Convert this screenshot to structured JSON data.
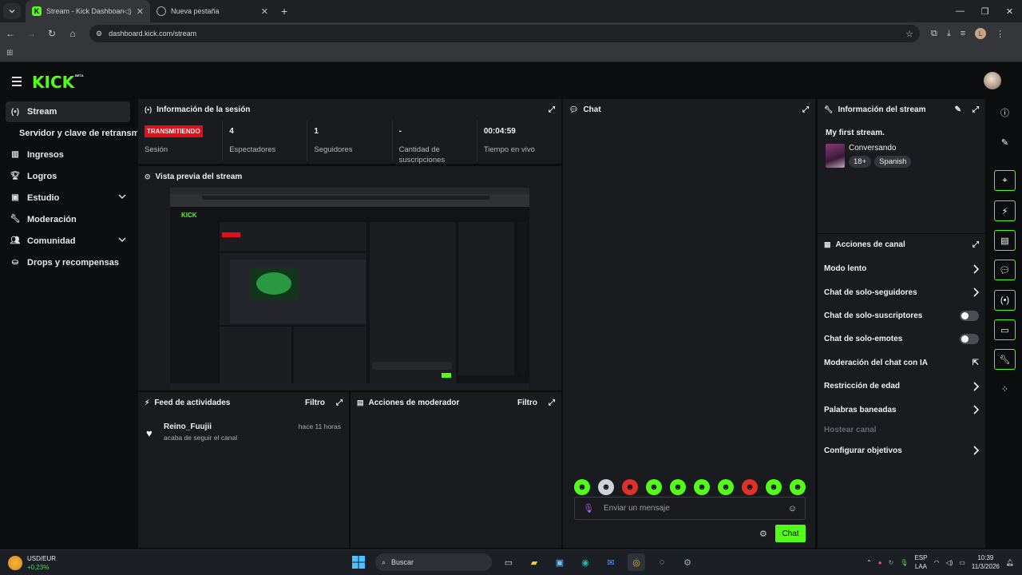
{
  "browser": {
    "tabs": [
      {
        "title": "Stream - Kick Dashboard",
        "active": true
      },
      {
        "title": "Nueva pestaña",
        "active": false
      }
    ],
    "url": "dashboard.kick.com/stream",
    "profile_initial": "L"
  },
  "app": {
    "logo": "KICK",
    "logo_badge": "BETA",
    "nav": [
      {
        "label": "Stream",
        "icon": "broadcast-icon",
        "active": true
      },
      {
        "label": "Servidor y clave de retransmisión",
        "sub": true
      },
      {
        "label": "Ingresos",
        "icon": "chart-icon"
      },
      {
        "label": "Logros",
        "icon": "trophy-icon"
      },
      {
        "label": "Estudio",
        "icon": "studio-icon",
        "expandable": true
      },
      {
        "label": "Moderación",
        "icon": "wrench-icon"
      },
      {
        "label": "Comunidad",
        "icon": "community-icon",
        "expandable": true
      },
      {
        "label": "Drops y recompensas",
        "icon": "drops-icon"
      }
    ],
    "session": {
      "title": "Información de la sesión",
      "status_badge": "TRANSMITIENDO",
      "stats": [
        {
          "value": "",
          "label": "Sesión"
        },
        {
          "value": "4",
          "label": "Espectadores"
        },
        {
          "value": "1",
          "label": "Seguidores"
        },
        {
          "value": "-",
          "label": "Cantidad de suscripciones"
        },
        {
          "value": "00:04:59",
          "label": "Tiempo en vivo"
        }
      ]
    },
    "preview": {
      "title": "Vista previa del stream"
    },
    "activity_feed": {
      "title": "Feed de actividades",
      "filter": "Filtro",
      "items": [
        {
          "name": "Reino_Fuujii",
          "desc": "acaba de seguir el canal",
          "time": "hace 11 horas"
        }
      ]
    },
    "mod_actions": {
      "title": "Acciones de moderador",
      "filter": "Filtro"
    },
    "chat": {
      "title": "Chat",
      "placeholder": "Enviar un mensaje",
      "send_label": "Chat",
      "emote_colors": [
        "#53fc18",
        "#cfd2d6",
        "#e0302b",
        "#53fc18",
        "#53fc18",
        "#53fc18",
        "#53fc18",
        "#e0302b",
        "#53fc18",
        "#53fc18"
      ]
    },
    "stream_info": {
      "title": "Información del stream",
      "stream_title": "My first stream.",
      "category": "Conversando",
      "tags": [
        "18+",
        "Spanish"
      ]
    },
    "channel_actions": {
      "title": "Acciones de canal",
      "items": [
        {
          "label": "Modo lento",
          "control": "chevron"
        },
        {
          "label": "Chat de solo-seguidores",
          "control": "chevron"
        },
        {
          "label": "Chat de solo-suscriptores",
          "control": "toggle",
          "on": false
        },
        {
          "label": "Chat de solo-emotes",
          "control": "toggle",
          "on": false
        },
        {
          "label": "Moderación del chat con IA",
          "control": "external"
        },
        {
          "label": "Restricción de edad",
          "control": "chevron"
        },
        {
          "label": "Palabras baneadas",
          "control": "chevron"
        },
        {
          "label": "Hostear canal",
          "control": "none",
          "disabled": true
        },
        {
          "label": "Configurar objetivos",
          "control": "chevron"
        }
      ]
    }
  },
  "taskbar": {
    "ticker_name": "USD/EUR",
    "ticker_change": "+0,23%",
    "search_placeholder": "Buscar",
    "lang_line1": "ESP",
    "lang_line2": "LAA",
    "time": "10:39",
    "date": "11/3/2026"
  },
  "colors": {
    "accent": "#53fc18",
    "live": "#e2101b",
    "panel": "#191b1f"
  }
}
